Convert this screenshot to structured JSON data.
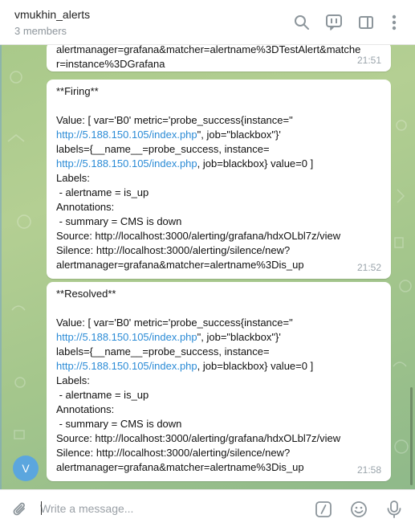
{
  "header": {
    "title": "vmukhin_alerts",
    "subtitle": "3 members",
    "icons": [
      "search-icon",
      "bot-commands-icon",
      "sidebar-icon",
      "more-vertical-icon"
    ]
  },
  "colors": {
    "link": "#2b8bd6",
    "avatar": "#5ba6de",
    "background": "#a9c98a",
    "time": "#9aa4ab"
  },
  "messages": [
    {
      "lines": [
        [
          {
            "t": "alertmanager=grafana&matcher=alertname%3DTestAlert&matche"
          }
        ],
        [
          {
            "t": "r=instance%3DGrafana"
          }
        ]
      ],
      "time": "21:51"
    },
    {
      "lines": [
        [
          {
            "t": "**Firing**"
          }
        ],
        [
          {
            "t": ""
          }
        ],
        [
          {
            "t": "Value: [ var='B0' metric='probe_success{instance=\""
          }
        ],
        [
          {
            "t": "http://5.188.150.105/index.php",
            "link": true
          },
          {
            "t": "\", job=\"blackbox\"}'"
          }
        ],
        [
          {
            "t": "labels={__name__=probe_success, instance="
          }
        ],
        [
          {
            "t": "http://5.188.150.105/index.php",
            "link": true
          },
          {
            "t": ", job=blackbox} value=0 ]"
          }
        ],
        [
          {
            "t": "Labels:"
          }
        ],
        [
          {
            "t": " - alertname = is_up"
          }
        ],
        [
          {
            "t": "Annotations:"
          }
        ],
        [
          {
            "t": " - summary = CMS is down"
          }
        ],
        [
          {
            "t": "Source: http://localhost:3000/alerting/grafana/hdxOLbl7z/view"
          }
        ],
        [
          {
            "t": "Silence: http://localhost:3000/alerting/silence/new?"
          }
        ],
        [
          {
            "t": "alertmanager=grafana&matcher=alertname%3Dis_up"
          }
        ]
      ],
      "time": "21:52"
    },
    {
      "lines": [
        [
          {
            "t": "**Resolved**"
          }
        ],
        [
          {
            "t": ""
          }
        ],
        [
          {
            "t": "Value: [ var='B0' metric='probe_success{instance=\""
          }
        ],
        [
          {
            "t": "http://5.188.150.105/index.php",
            "link": true
          },
          {
            "t": "\", job=\"blackbox\"}'"
          }
        ],
        [
          {
            "t": "labels={__name__=probe_success, instance="
          }
        ],
        [
          {
            "t": "http://5.188.150.105/index.php",
            "link": true
          },
          {
            "t": ", job=blackbox} value=0 ]"
          }
        ],
        [
          {
            "t": "Labels:"
          }
        ],
        [
          {
            "t": " - alertname = is_up"
          }
        ],
        [
          {
            "t": "Annotations:"
          }
        ],
        [
          {
            "t": " - summary = CMS is down"
          }
        ],
        [
          {
            "t": "Source: http://localhost:3000/alerting/grafana/hdxOLbl7z/view"
          }
        ],
        [
          {
            "t": "Silence: http://localhost:3000/alerting/silence/new?"
          }
        ],
        [
          {
            "t": "alertmanager=grafana&matcher=alertname%3Dis_up"
          }
        ]
      ],
      "time": "21:58"
    }
  ],
  "sender": {
    "avatar_initial": "V"
  },
  "composer": {
    "placeholder": "Write a message...",
    "icons": [
      "attach-icon",
      "bot-command-icon",
      "emoji-icon",
      "microphone-icon"
    ]
  }
}
